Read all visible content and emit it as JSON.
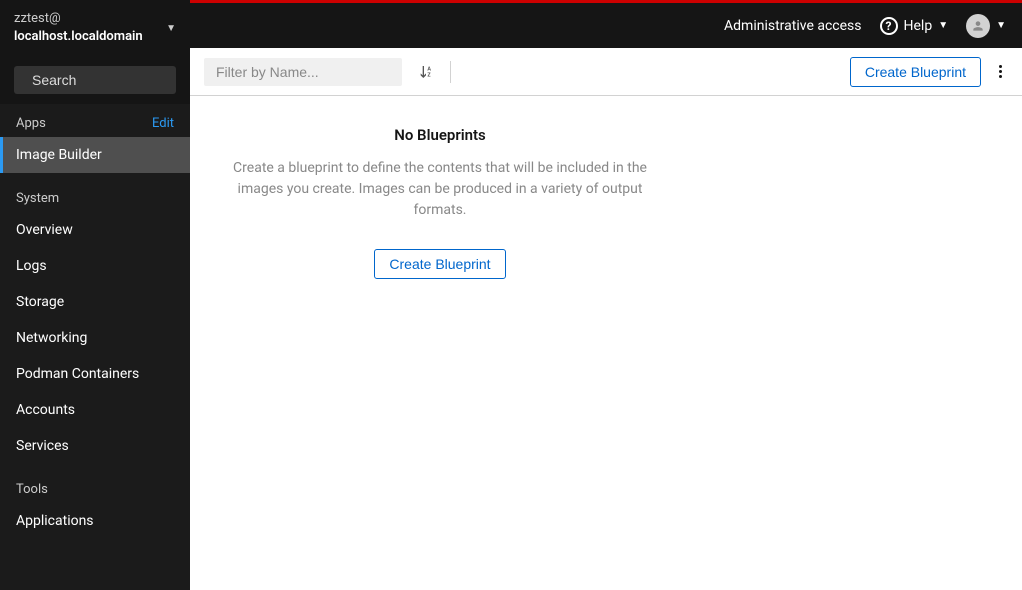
{
  "sidebar": {
    "user": "zztest@",
    "host": "localhost.localdomain",
    "search_placeholder": "Search",
    "sections": {
      "apps": {
        "label": "Apps",
        "edit": "Edit"
      },
      "system": {
        "label": "System"
      },
      "tools": {
        "label": "Tools"
      }
    },
    "items": {
      "image_builder": "Image Builder",
      "overview": "Overview",
      "logs": "Logs",
      "storage": "Storage",
      "networking": "Networking",
      "podman": "Podman Containers",
      "accounts": "Accounts",
      "services": "Services",
      "applications": "Applications"
    }
  },
  "topbar": {
    "admin": "Administrative access",
    "help": "Help"
  },
  "toolbar": {
    "filter_placeholder": "Filter by Name...",
    "create": "Create Blueprint"
  },
  "empty": {
    "title": "No Blueprints",
    "desc": "Create a blueprint to define the contents that will be included in the images you create. Images can be produced in a variety of output formats.",
    "button": "Create Blueprint"
  }
}
